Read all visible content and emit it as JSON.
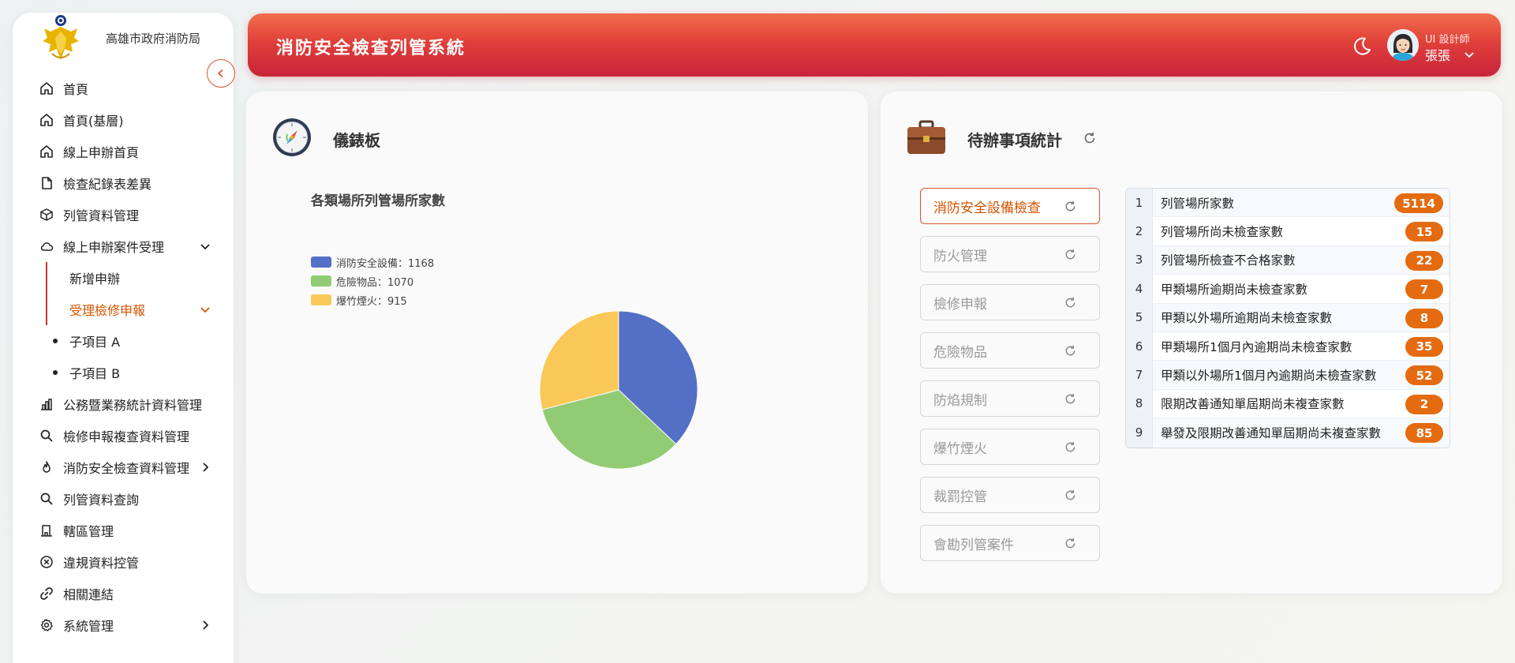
{
  "brand": {
    "org_name": "高雄市政府消防局"
  },
  "sidebar": {
    "items": [
      {
        "label": "首頁",
        "icon": "home-icon"
      },
      {
        "label": "首頁(基層)",
        "icon": "home-icon"
      },
      {
        "label": "線上申辦首頁",
        "icon": "home-icon"
      },
      {
        "label": "檢查紀錄表差異",
        "icon": "file-icon"
      },
      {
        "label": "列管資料管理",
        "icon": "box-icon"
      },
      {
        "label": "線上申辦案件受理",
        "icon": "cloud-icon",
        "expanded": true
      },
      {
        "label": "新增申辦"
      },
      {
        "label": "受理檢修申報",
        "active": true
      },
      {
        "label": "子項目 A"
      },
      {
        "label": "子項目 B"
      },
      {
        "label": "公務暨業務統計資料管理",
        "icon": "bar-chart-icon"
      },
      {
        "label": "檢修申報複查資料管理",
        "icon": "search-icon"
      },
      {
        "label": "消防安全檢查資料管理",
        "icon": "flame-icon"
      },
      {
        "label": "列管資料查詢",
        "icon": "search-icon"
      },
      {
        "label": "轄區管理",
        "icon": "building-icon"
      },
      {
        "label": "違規資料控管",
        "icon": "x-circle-icon"
      },
      {
        "label": "相關連結",
        "icon": "link-icon"
      },
      {
        "label": "系統管理",
        "icon": "gear-icon"
      }
    ]
  },
  "header": {
    "title": "消防安全檢查列管系統",
    "user_role": "UI 設計師",
    "user_name": "張張"
  },
  "dashboard": {
    "title": "儀錶板",
    "chart_data": {
      "type": "pie",
      "title": "各類場所列管場所家數",
      "categories": [
        "消防安全設備",
        "危險物品",
        "爆竹煙火"
      ],
      "values": [
        1168,
        1070,
        915
      ],
      "legend_labels": [
        "消防安全設備：1168",
        "危險物品：1070",
        "爆竹煙火：915"
      ],
      "colors": [
        "#5470c6",
        "#91cc75",
        "#fac858"
      ],
      "legend_position": "top-left"
    }
  },
  "todo": {
    "title": "待辦事項統計",
    "categories": [
      {
        "label": "消防安全設備檢查",
        "active": true
      },
      {
        "label": "防火管理"
      },
      {
        "label": "檢修申報"
      },
      {
        "label": "危險物品"
      },
      {
        "label": "防焰規制"
      },
      {
        "label": "爆竹煙火"
      },
      {
        "label": "裁罰控管"
      },
      {
        "label": "會勘列管案件"
      }
    ],
    "stats": [
      {
        "no": "1",
        "label": "列管場所家數",
        "count": "5114"
      },
      {
        "no": "2",
        "label": "列管場所尚未檢查家數",
        "count": "15"
      },
      {
        "no": "3",
        "label": "列管場所檢查不合格家數",
        "count": "22"
      },
      {
        "no": "4",
        "label": "甲類場所逾期尚未檢查家數",
        "count": "7"
      },
      {
        "no": "5",
        "label": "甲類以外場所逾期尚未檢查家數",
        "count": "8"
      },
      {
        "no": "6",
        "label": "甲類場所1個月內逾期尚未檢查家數",
        "count": "35"
      },
      {
        "no": "7",
        "label": "甲類以外場所1個月內逾期尚未檢查家數",
        "count": "52"
      },
      {
        "no": "8",
        "label": "限期改善通知單屆期尚未複查家數",
        "count": "2"
      },
      {
        "no": "9",
        "label": "舉發及限期改善通知單屆期尚未複查家數",
        "count": "85"
      }
    ]
  },
  "colors": {
    "accent": "#d9532b",
    "header": "#e0403a",
    "badge": "#e46b10"
  }
}
